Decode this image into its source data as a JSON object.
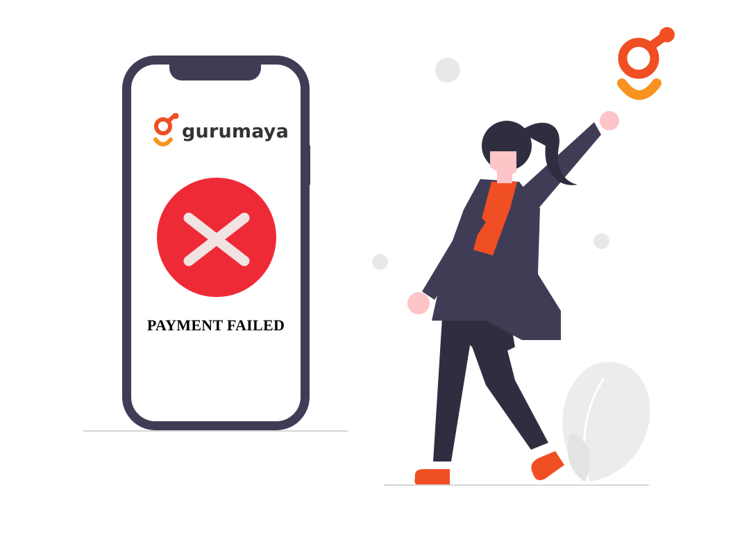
{
  "brand": {
    "name": "gurumaya",
    "colors": {
      "primary": "#f04e23",
      "secondary": "#f7931e"
    }
  },
  "payment": {
    "status": "PAYMENT FAILED",
    "status_icon": "close-icon",
    "status_color": "#ef2a37"
  },
  "illustration": {
    "accent": "#f04e23",
    "dark": "#2f2e41",
    "jacket": "#3f3d56",
    "skin": "#fdc5c7"
  }
}
